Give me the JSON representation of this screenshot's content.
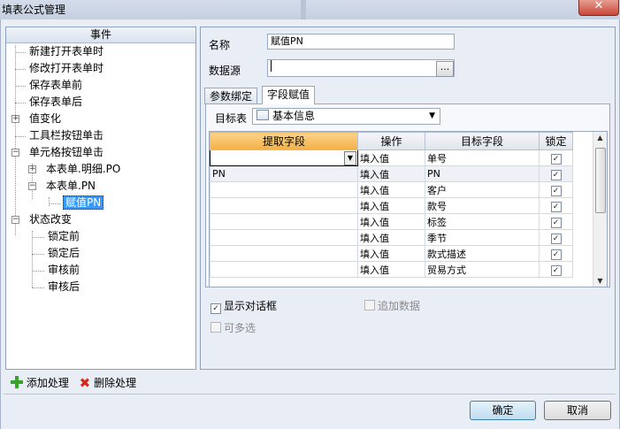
{
  "window": {
    "title": "填表公式管理"
  },
  "tree": {
    "header": "事件",
    "nodes": [
      {
        "label": "新建打开表单时",
        "selected": false
      },
      {
        "label": "修改打开表单时",
        "selected": false
      },
      {
        "label": "保存表单前",
        "selected": false
      },
      {
        "label": "保存表单后",
        "selected": false
      },
      {
        "label": "值变化",
        "selected": false,
        "expander": "+"
      },
      {
        "label": "工具栏按钮单击",
        "selected": false
      },
      {
        "label": "单元格按钮单击",
        "selected": false,
        "expander": "-"
      },
      {
        "label": "本表单.明细.PO",
        "selected": false,
        "expander": "+"
      },
      {
        "label": "本表单.PN",
        "selected": false,
        "expander": "-"
      },
      {
        "label": "赋值PN",
        "selected": true
      },
      {
        "label": "状态改变",
        "selected": false,
        "expander": "-"
      },
      {
        "label": "锁定前",
        "selected": false
      },
      {
        "label": "锁定后",
        "selected": false
      },
      {
        "label": "审核前",
        "selected": false
      },
      {
        "label": "审核后",
        "selected": false
      }
    ]
  },
  "bottom_actions": {
    "add_label": "添加处理",
    "delete_label": "删除处理"
  },
  "form": {
    "name_label": "名称",
    "name_value": "赋值PN",
    "datasource_label": "数据源",
    "datasource_value": "",
    "browse_label": "..."
  },
  "tabs": [
    {
      "label": "参数绑定",
      "active": false
    },
    {
      "label": "字段赋值",
      "active": true
    }
  ],
  "target": {
    "label": "目标表",
    "value": "基本信息"
  },
  "grid": {
    "columns": [
      "提取字段",
      "操作",
      "目标字段",
      "锁定"
    ],
    "rows": [
      {
        "source": "",
        "op": "填入值",
        "target": "单号",
        "locked": true
      },
      {
        "source": "PN",
        "op": "填入值",
        "target": "PN",
        "locked": true
      },
      {
        "source": "",
        "op": "填入值",
        "target": "客户",
        "locked": true
      },
      {
        "source": "",
        "op": "填入值",
        "target": "款号",
        "locked": true
      },
      {
        "source": "",
        "op": "填入值",
        "target": "标签",
        "locked": true
      },
      {
        "source": "",
        "op": "填入值",
        "target": "季节",
        "locked": true
      },
      {
        "source": "",
        "op": "填入值",
        "target": "款式描述",
        "locked": true
      },
      {
        "source": "",
        "op": "填入值",
        "target": "贸易方式",
        "locked": true
      }
    ]
  },
  "options": {
    "show_dialog": {
      "label": "显示对话框",
      "checked": true
    },
    "append_data": {
      "label": "追加数据",
      "checked": false,
      "enabled": false
    },
    "multi_select": {
      "label": "可多选",
      "checked": false,
      "enabled": false
    }
  },
  "buttons": {
    "ok": "确定",
    "cancel": "取消"
  }
}
